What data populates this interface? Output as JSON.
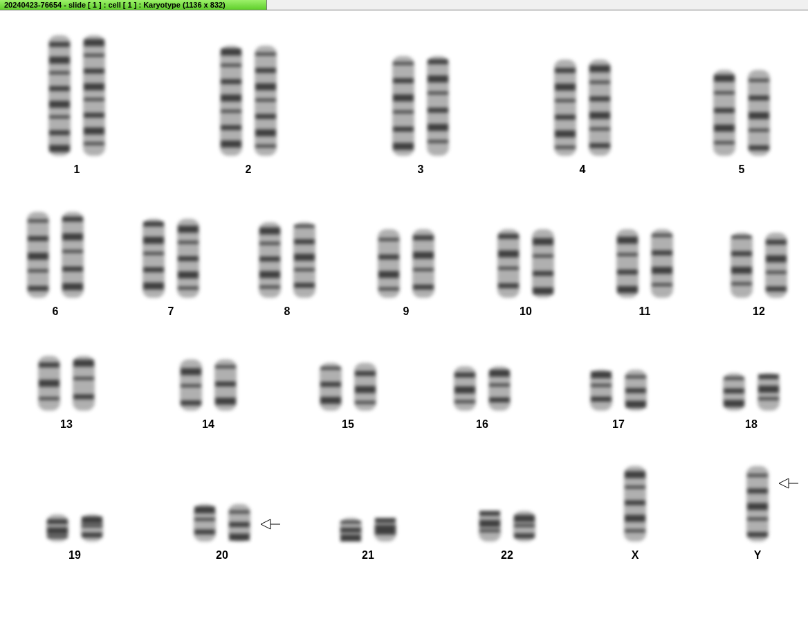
{
  "window": {
    "title": "20240423-76654 - slide [ 1 ] : cell [ 1 ] : Karyotype  (1136 x 832)"
  },
  "karyotype": [
    {
      "label": "1",
      "kind": "pair",
      "marked": false
    },
    {
      "label": "2",
      "kind": "pair",
      "marked": false
    },
    {
      "label": "3",
      "kind": "pair",
      "marked": false
    },
    {
      "label": "4",
      "kind": "pair",
      "marked": false
    },
    {
      "label": "5",
      "kind": "pair",
      "marked": false
    },
    {
      "label": "6",
      "kind": "pair",
      "marked": false
    },
    {
      "label": "7",
      "kind": "pair",
      "marked": false
    },
    {
      "label": "8",
      "kind": "pair",
      "marked": false
    },
    {
      "label": "9",
      "kind": "pair",
      "marked": false
    },
    {
      "label": "10",
      "kind": "pair",
      "marked": false
    },
    {
      "label": "11",
      "kind": "pair",
      "marked": false
    },
    {
      "label": "12",
      "kind": "pair",
      "marked": false
    },
    {
      "label": "13",
      "kind": "pair",
      "marked": false
    },
    {
      "label": "14",
      "kind": "pair",
      "marked": false
    },
    {
      "label": "15",
      "kind": "pair",
      "marked": false
    },
    {
      "label": "16",
      "kind": "pair",
      "marked": false
    },
    {
      "label": "17",
      "kind": "pair",
      "marked": false
    },
    {
      "label": "18",
      "kind": "pair",
      "marked": false
    },
    {
      "label": "19",
      "kind": "pair",
      "marked": false
    },
    {
      "label": "20",
      "kind": "pair",
      "marked": true
    },
    {
      "label": "21",
      "kind": "pair",
      "marked": false
    },
    {
      "label": "22",
      "kind": "pair",
      "marked": false
    },
    {
      "label": "X",
      "kind": "single",
      "marked": false
    },
    {
      "label": "Y",
      "kind": "single",
      "marked": true
    }
  ]
}
